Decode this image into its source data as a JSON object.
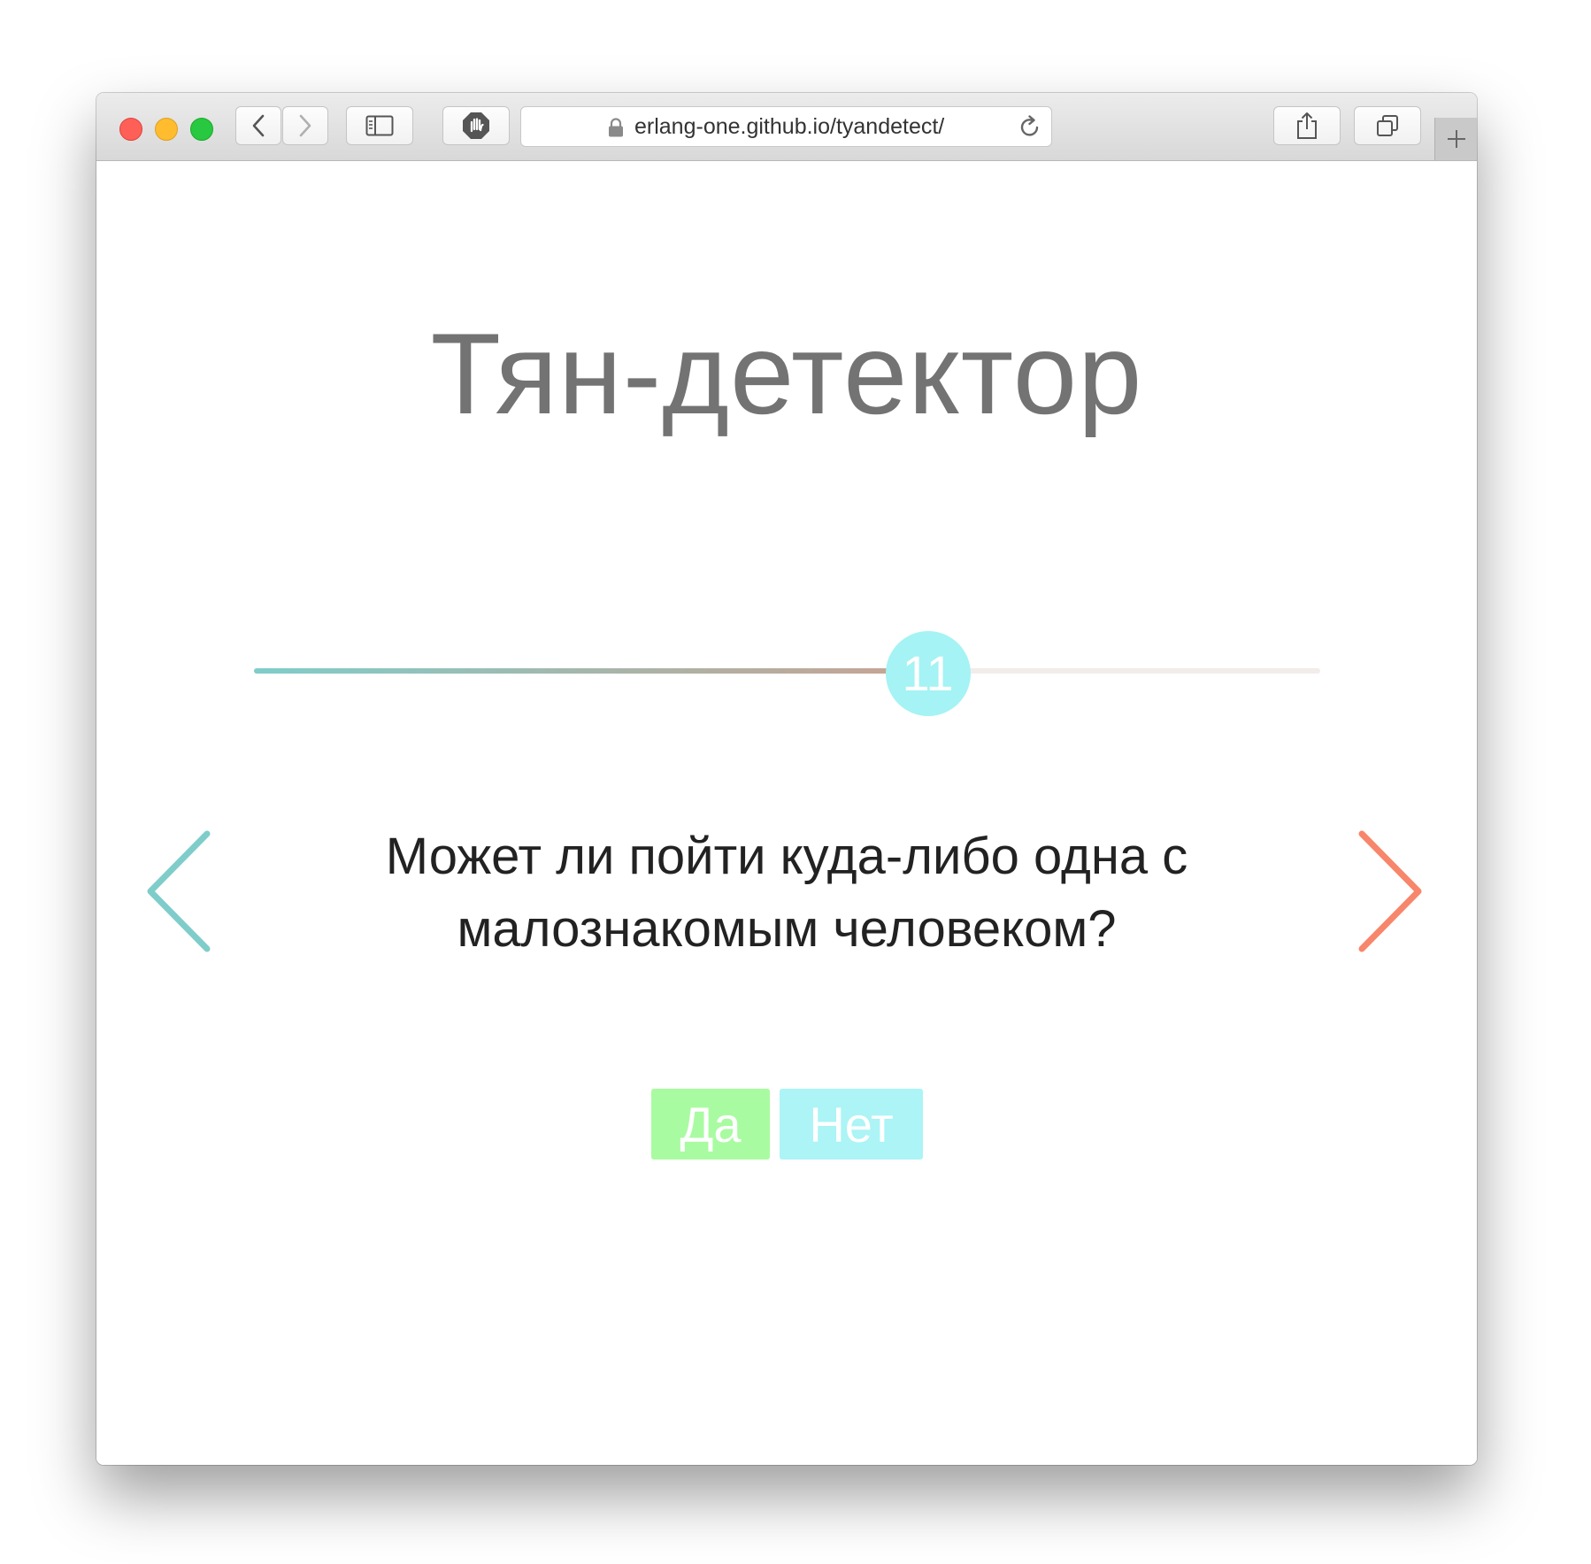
{
  "browser": {
    "url_host": "erlang-one.github.io",
    "url_path": "/tyandetect/"
  },
  "page": {
    "title": "Тян-детектор",
    "question": "Может ли пойти куда-либо одна с малознакомым человеком?",
    "progress": {
      "value": 11,
      "label": "11",
      "fraction": 0.632
    },
    "buttons": {
      "yes": "Да",
      "no": "Нет"
    },
    "nav": {
      "prev_icon": "chevron-left-icon",
      "next_icon": "chevron-right-icon"
    }
  },
  "colors": {
    "prev_arrow": "#7fcdca",
    "next_arrow": "#f7866b",
    "yes_button": "#a9fba1",
    "no_button": "#acf4f6",
    "knob": "#a5f3f4"
  }
}
